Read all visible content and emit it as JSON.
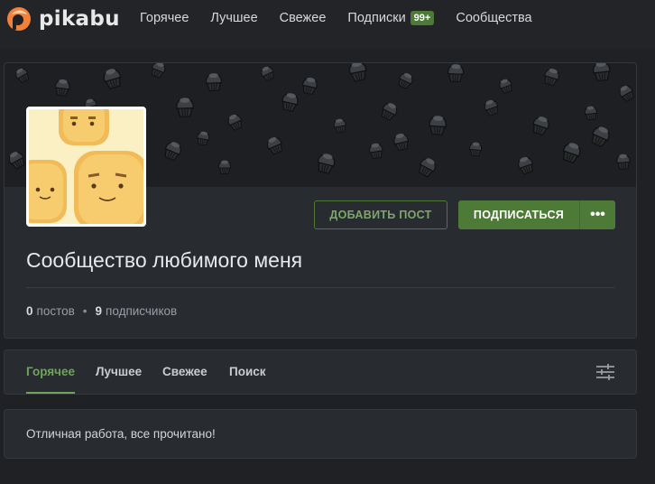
{
  "header": {
    "logo_text": "pikabu",
    "nav": [
      {
        "label": "Горячее"
      },
      {
        "label": "Лучшее"
      },
      {
        "label": "Свежее"
      },
      {
        "label": "Подписки",
        "badge": "99+"
      },
      {
        "label": "Сообщества"
      }
    ]
  },
  "community": {
    "title": "Сообщество любимого меня",
    "add_post_label": "ДОБАВИТЬ ПОСТ",
    "subscribe_label": "ПОДПИСАТЬСЯ",
    "more_label": "•••",
    "stats": {
      "posts_count": "0",
      "posts_label": "постов",
      "separator": "•",
      "subscribers_count": "9",
      "subscribers_label": "подписчиков"
    }
  },
  "tabs": [
    {
      "label": "Горячее",
      "active": true
    },
    {
      "label": "Лучшее",
      "active": false
    },
    {
      "label": "Свежее",
      "active": false
    },
    {
      "label": "Поиск",
      "active": false
    }
  ],
  "feed": {
    "empty_message": "Отличная работа, все прочитано!"
  },
  "colors": {
    "accent": "#4e7a37",
    "accent_text": "#6ea559",
    "logo_orange": "#f2813a",
    "background": "#1f2124",
    "card": "#282b2f"
  },
  "icons": {
    "logo": "pikabu-logo-icon",
    "filter": "sliders-icon",
    "banner_pattern": "cupcake-icon",
    "more": "more-dots-icon"
  }
}
